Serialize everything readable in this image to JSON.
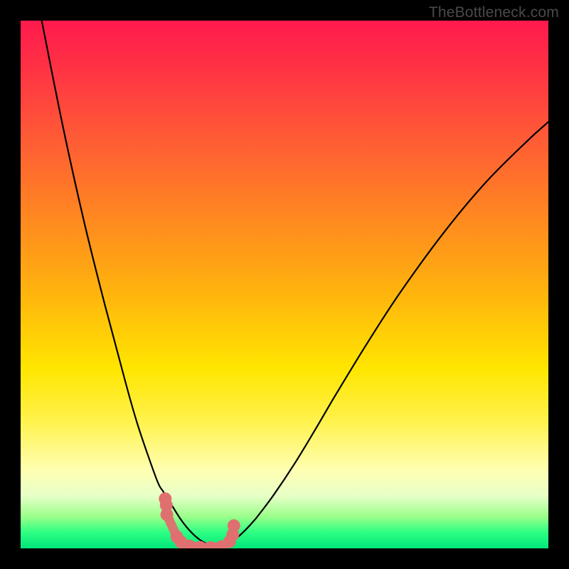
{
  "watermark": "TheBottleneck.com",
  "chart_data": {
    "type": "line",
    "title": "",
    "xlabel": "",
    "ylabel": "",
    "xlim": [
      0,
      100
    ],
    "ylim": [
      0,
      100
    ],
    "grid": false,
    "legend": false,
    "series": [
      {
        "name": "left-curve",
        "x": [
          4,
          8,
          12,
          16,
          20,
          22,
          24,
          26,
          27,
          28,
          29,
          30,
          31,
          32,
          33,
          34,
          35,
          36,
          37
        ],
        "values": [
          100,
          80,
          62,
          46,
          31,
          24,
          18,
          12.5,
          10.8,
          9.2,
          7.6,
          6,
          4.6,
          3.4,
          2.4,
          1.6,
          1,
          0.5,
          0.18
        ]
      },
      {
        "name": "right-curve",
        "x": [
          37,
          38,
          39,
          40,
          41,
          42,
          43,
          44,
          45,
          48,
          52,
          56,
          60,
          66,
          72,
          80,
          88,
          96,
          100
        ],
        "values": [
          0.15,
          0.35,
          0.75,
          1.3,
          2,
          2.9,
          3.9,
          5,
          6.2,
          10.2,
          16.2,
          22.8,
          29.6,
          39.4,
          48.6,
          59.6,
          69.2,
          77.2,
          80.8
        ]
      },
      {
        "name": "segment-cluster",
        "x": [
          27.4,
          27.6,
          27.7,
          29.6,
          30.4,
          32,
          34,
          36,
          38,
          39.6,
          40.2,
          40.4
        ],
        "values": [
          9.4,
          8.2,
          6.4,
          2.2,
          1.2,
          0.45,
          0.2,
          0.15,
          0.3,
          1.3,
          2.6,
          4.3
        ]
      }
    ],
    "annotations": [],
    "colors": {
      "curve": "#000000",
      "segment": "#e07070",
      "gradient_top": "#ff1a4d",
      "gradient_mid": "#ffe600",
      "gradient_bottom": "#00e67a"
    }
  }
}
